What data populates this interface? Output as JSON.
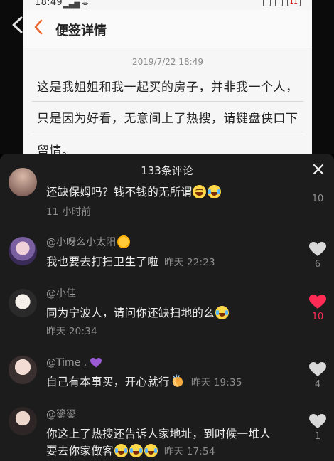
{
  "background": {
    "status_bar": {
      "time": "18:49",
      "battery": "11"
    },
    "memo_title": "便签详情",
    "memo_date": "2019/7/22 18:49",
    "memo_lines": [
      "这是我姐姐和我一起买的房子，并非我一个人，",
      "只是因为好看，无意间上了热搜，请键盘侠口下",
      "留情。"
    ]
  },
  "panel": {
    "comment_count": "133条评论",
    "close_icon": "close-icon"
  },
  "comments": [
    {
      "name": "",
      "text": "还缺保姆吗？钱不钱的无所谓",
      "emojis": [
        "laugh-emoji",
        "cry-laugh-emoji"
      ],
      "time": "11 小时前",
      "likes": "10",
      "liked": false
    },
    {
      "name": "@小呀么小太阳",
      "name_emoji": "sun-emoji",
      "text": "我也要去打扫卫生了啦",
      "time": "昨天 22:23",
      "likes": "6",
      "liked": false
    },
    {
      "name": "@小佳",
      "text": "同为宁波人，请问你还缺扫地的么",
      "emojis": [
        "cry-laugh-emoji"
      ],
      "time": "昨天 20:34",
      "likes": "10",
      "liked": true
    },
    {
      "name": "@Time .",
      "name_emoji": "purple-heart-emoji",
      "text": "自己有本事买，开心就行",
      "emojis": [
        "clap-emoji"
      ],
      "time": "昨天 19:35",
      "likes": "4",
      "liked": false
    },
    {
      "name": "@鎏鎏",
      "text_line1": "你这上了热搜还告诉人家地址，到时候一堆人",
      "text_line2": "要去你家做客",
      "emojis": [
        "cry-laugh-emoji",
        "cry-laugh-emoji",
        "cry-laugh-emoji"
      ],
      "time": "昨天 17:54",
      "likes": "1",
      "liked": false
    }
  ],
  "colors": {
    "panel_bg": "#1c1c1c",
    "liked_heart": "#fe2c55",
    "unliked_heart": "#d9d9d9"
  }
}
